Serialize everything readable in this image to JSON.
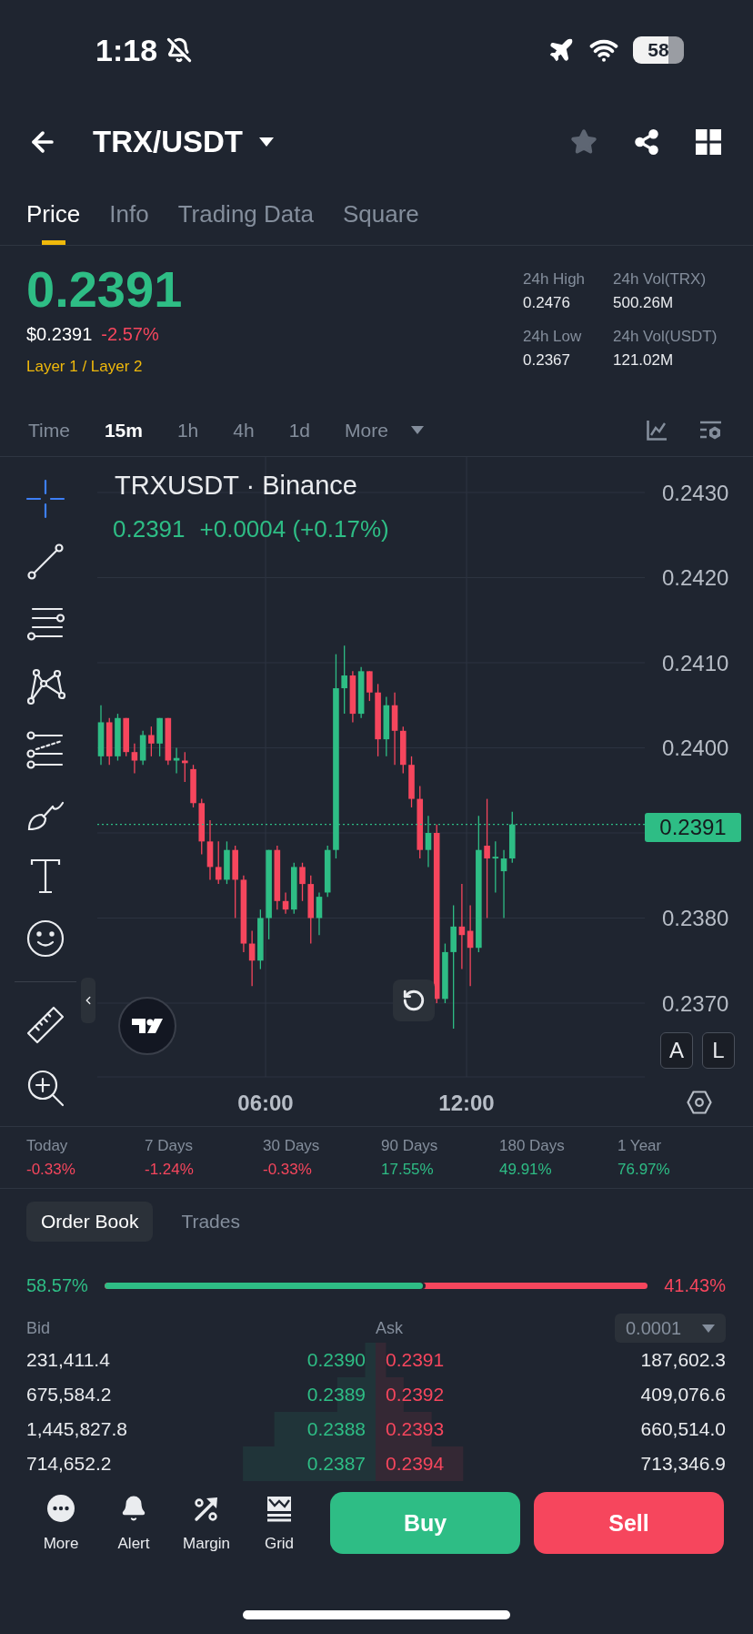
{
  "status_bar": {
    "time": "1:18",
    "battery": "58"
  },
  "header": {
    "pair": "TRX/USDT",
    "favorite": false
  },
  "tabs": [
    {
      "label": "Price",
      "selected": true
    },
    {
      "label": "Info",
      "selected": false
    },
    {
      "label": "Trading Data",
      "selected": false
    },
    {
      "label": "Square",
      "selected": false
    }
  ],
  "ticker": {
    "price": "0.2391",
    "fiat_price": "$0.2391",
    "change": "-2.57%",
    "category": "Layer 1 / Layer 2",
    "stats": [
      {
        "label": "24h High",
        "value": "0.2476"
      },
      {
        "label": "24h Vol(TRX)",
        "value": "500.26M"
      },
      {
        "label": "24h Low",
        "value": "0.2367"
      },
      {
        "label": "24h Vol(USDT)",
        "value": "121.02M"
      }
    ]
  },
  "intervals": {
    "items": [
      {
        "label": "Time",
        "selected": false
      },
      {
        "label": "15m",
        "selected": true
      },
      {
        "label": "1h",
        "selected": false
      },
      {
        "label": "4h",
        "selected": false
      },
      {
        "label": "1d",
        "selected": false
      }
    ],
    "more": "More"
  },
  "chart": {
    "title": "TRXUSDT · Binance",
    "last": "0.2391",
    "change": "+0.0004 (+0.17%)",
    "price_axis": [
      "0.2430",
      "0.2420",
      "0.2410",
      "0.2400",
      "0.2380",
      "0.2370"
    ],
    "time_axis": [
      "06:00",
      "12:00"
    ],
    "current_price": "0.2391",
    "scale_buttons": [
      "A",
      "L"
    ],
    "tools": [
      {
        "kind": "crosshair",
        "selected": true
      },
      {
        "kind": "trend_line",
        "selected": false
      },
      {
        "kind": "parallel_lines",
        "selected": false
      },
      {
        "kind": "pattern",
        "selected": false
      },
      {
        "kind": "fib_levels",
        "selected": false
      },
      {
        "kind": "brush",
        "selected": false
      },
      {
        "kind": "text",
        "selected": false
      },
      {
        "kind": "emoji",
        "selected": false
      },
      {
        "kind": "ruler",
        "selected": false
      },
      {
        "kind": "zoom",
        "selected": false
      }
    ]
  },
  "performance": [
    {
      "label": "Today",
      "value": "-0.33%",
      "color": "#f6465d"
    },
    {
      "label": "7 Days",
      "value": "-1.24%",
      "color": "#f6465d"
    },
    {
      "label": "30 Days",
      "value": "-0.33%",
      "color": "#f6465d"
    },
    {
      "label": "90 Days",
      "value": "17.55%",
      "color": "#2ebd85"
    },
    {
      "label": "180 Days",
      "value": "49.91%",
      "color": "#2ebd85"
    },
    {
      "label": "1 Year",
      "value": "76.97%",
      "color": "#2ebd85"
    }
  ],
  "order_book": {
    "tabs": [
      {
        "label": "Order Book",
        "selected": true
      },
      {
        "label": "Trades",
        "selected": false
      }
    ],
    "ratio": {
      "level": 0.5857,
      "bid_text": "58.57%",
      "ask_text": "41.43%"
    },
    "bid_label": "Bid",
    "ask_label": "Ask",
    "precision": "0.0001",
    "rows": [
      {
        "bid": {
          "amount": "231,411.4",
          "price": "0.2390"
        },
        "ask": {
          "price": "0.2391",
          "amount": "187,602.3"
        }
      },
      {
        "bid": {
          "amount": "675,584.2",
          "price": "0.2389"
        },
        "ask": {
          "price": "0.2392",
          "amount": "409,076.6"
        }
      },
      {
        "bid": {
          "amount": "1,445,827.8",
          "price": "0.2388"
        },
        "ask": {
          "price": "0.2393",
          "amount": "660,514.0"
        }
      },
      {
        "bid": {
          "amount": "714,652.2",
          "price": "0.2387"
        },
        "ask": {
          "price": "0.2394",
          "amount": "713,346.9"
        }
      }
    ]
  },
  "actions": {
    "nav": [
      {
        "kind": "more",
        "label": "More"
      },
      {
        "kind": "alert",
        "label": "Alert"
      },
      {
        "kind": "margin",
        "label": "Margin"
      },
      {
        "kind": "grid",
        "label": "Grid"
      }
    ],
    "buy": "Buy",
    "sell": "Sell"
  }
}
